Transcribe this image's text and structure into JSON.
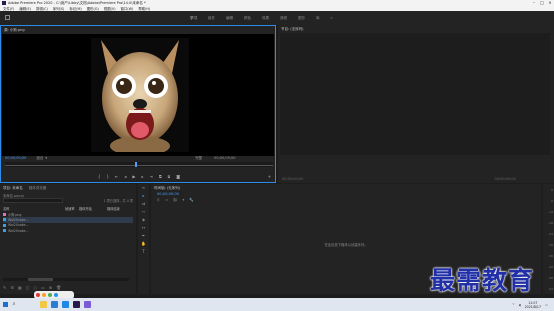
{
  "titlebar": {
    "title": "Adobe Premiere Pro 2020 - C:\\用户\\Libby\\文档\\Adobe\\Premiere Pro\\14.0\\未命名 *"
  },
  "menu": [
    "文件(F)",
    "编辑(E)",
    "剪辑(C)",
    "序列(S)",
    "标记(M)",
    "图形(G)",
    "视图(V)",
    "窗口(W)",
    "帮助(H)"
  ],
  "workspaces": {
    "tabs": [
      "学习",
      "组件",
      "编辑",
      "颜色",
      "效果",
      "音频",
      "图形",
      "库"
    ],
    "active": "学习",
    "more": "»"
  },
  "source": {
    "tab": "源: 小狗.png",
    "timecode": "00;00;00;00",
    "fit": "适合",
    "quality": "完整",
    "duration": "00;00;05;00"
  },
  "program": {
    "tab": "节目: (无序列)",
    "timecode_left": "00;00;00;00",
    "timecode_right": "00;00;00;00"
  },
  "project": {
    "tabs": [
      "项目: 未命名",
      "媒体浏览器"
    ],
    "path": "未命名.prproj",
    "count": "1 项已选择，共 4 项",
    "columns": [
      "名称",
      "帧速率",
      "媒体开始",
      "媒体结束"
    ],
    "items": [
      {
        "name": "小狗.png",
        "color": "#e070c0",
        "rate": "",
        "start": "",
        "end": ""
      },
      {
        "name": "Wal2Snake...",
        "color": "#3aa0e0",
        "rate": "",
        "start": "",
        "end": ""
      },
      {
        "name": "Wal2Snake...",
        "color": "#3aa0e0",
        "rate": "",
        "start": "",
        "end": ""
      },
      {
        "name": "Wal2Snake...",
        "color": "#3aa0e0",
        "rate": "",
        "start": "",
        "end": ""
      }
    ]
  },
  "timeline": {
    "tab": "时间轴: (无序列)",
    "timecode": "00;00;00;00",
    "empty_hint": "在此处放下媒体以创建序列。"
  },
  "meter": {
    "ticks": [
      "0",
      "-6",
      "-12",
      "-18",
      "-24",
      "-30",
      "-36",
      "-42",
      "-48",
      "-54",
      "dB"
    ]
  },
  "watermark": "最需教育",
  "taskbar": {
    "time": "11:07",
    "date": "2021/8/17"
  },
  "icons": {
    "home": "home-icon",
    "search": "search-icon",
    "plus": "plus-icon"
  }
}
